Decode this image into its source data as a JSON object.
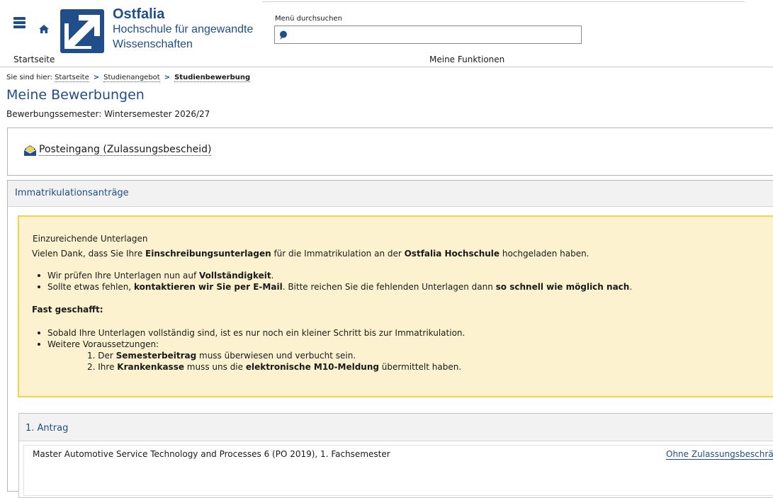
{
  "header": {
    "logo_name": "Ostfalia",
    "logo_sub1": "Hochschule für angewandte",
    "logo_sub2": "Wissenschaften",
    "search_label": "Menü durchsuchen",
    "search_value": "",
    "nav_start": "Startseite",
    "nav_functions": "Meine Funktionen",
    "brand_color": "#1f4e8a"
  },
  "breadcrumb": {
    "prefix": "Sie sind hier:",
    "items": [
      "Startseite",
      "Studienangebot",
      "Studienbewerbung"
    ]
  },
  "page": {
    "title": "Meine Bewerbungen",
    "semester": "Bewerbungssemester: Wintersemester 2026/27",
    "inbox_link": "Posteingang (Zulassungsbescheid)"
  },
  "immat": {
    "title": "Immatrikulationsanträge",
    "notice": {
      "title": "Einzureichende Unterlagen",
      "intro": [
        "Vielen Dank, dass Sie Ihre ",
        "Einschreibungsunterlagen",
        " für die Immatrikulation an der ",
        "Ostfalia Hochschule",
        " hochgeladen haben."
      ],
      "list1": [
        [
          "Wir prüfen Ihre Unterlagen nun auf ",
          "Vollständigkeit",
          "."
        ],
        [
          "Sollte etwas fehlen, ",
          "kontaktieren wir Sie per E-Mail",
          ". Bitte reichen Sie die fehlenden Unterlagen dann ",
          "so schnell wie möglich nach",
          "."
        ]
      ],
      "fast": "Fast geschafft:",
      "list2_a": "Sobald Ihre Unterlagen vollständig sind, ist es nur noch ein kleiner Schritt bis zur Immatrikulation.",
      "list2_b": "Weitere Voraussetzungen:",
      "ordered": [
        [
          "1. Der ",
          "Semesterbeitrag",
          " muss überwiesen und verbucht sein."
        ],
        [
          "2. Ihre ",
          "Krankenkasse",
          " muss uns die ",
          "elektronische M10-Meldung",
          " übermittelt haben."
        ]
      ],
      "accent_color": "#f3d34a",
      "bg_color": "#fcf2cf"
    },
    "antrag": {
      "title": "1. Antrag",
      "program": "Master Automotive Service Technology and Processes 6 (PO 2019), 1. Fachsemester",
      "status": "Ohne Zulassungsbeschrän"
    }
  }
}
